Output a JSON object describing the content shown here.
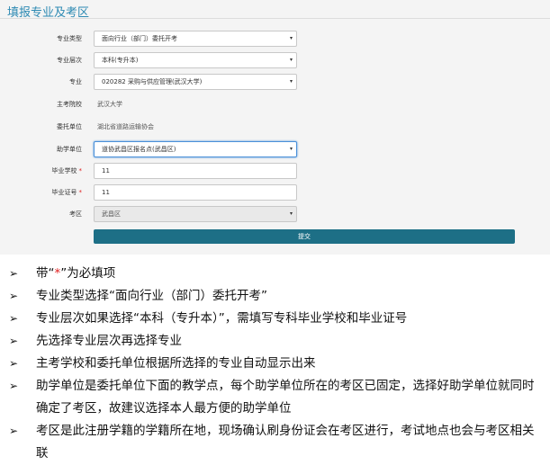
{
  "form": {
    "title": "填报专业及考区",
    "fields": [
      {
        "label": "专业类型",
        "value": "面向行业（部门）委托开考",
        "kind": "select"
      },
      {
        "label": "专业层次",
        "value": "本科(专升本)",
        "kind": "select"
      },
      {
        "label": "专业",
        "value": "020282 采购与供应管理(武汉大学)",
        "kind": "select"
      },
      {
        "label": "主考院校",
        "value": "武汉大学",
        "kind": "static"
      },
      {
        "label": "委托单位",
        "value": "湖北省道路运输协会",
        "kind": "static"
      },
      {
        "label": "助学单位",
        "value": "道协武昌区报名点(武昌区)",
        "kind": "select"
      },
      {
        "label": "毕业学校",
        "value": "11",
        "kind": "input",
        "required": true
      },
      {
        "label": "毕业证号",
        "value": "11",
        "kind": "input",
        "required": true
      },
      {
        "label": "考区",
        "value": "武昌区",
        "kind": "select-disabled"
      }
    ],
    "required_mark": "*",
    "caret": "▾",
    "submit_label": "提交"
  },
  "notes": {
    "bullet": "➢",
    "n1_pre": "带“",
    "n1_star": "*",
    "n1_post": "”为必填项",
    "n2": "专业类型选择“面向行业（部门）委托开考”",
    "n3": "专业层次如果选择“本科（专升本）”，需填写专科毕业学校和毕业证号",
    "n4": "先选择专业层次再选择专业",
    "n5": "主考学校和委托单位根据所选择的专业自动显示出来",
    "n6": "助学单位是委托单位下面的教学点，每个助学单位所在的考区已固定，选择好助学单位就同时确定了考区，故建议选择本人最方便的助学单位",
    "n7": "考区是此注册学籍的学籍所在地，现场确认刷身份证会在考区进行，考试地点也会与考区相关联"
  }
}
